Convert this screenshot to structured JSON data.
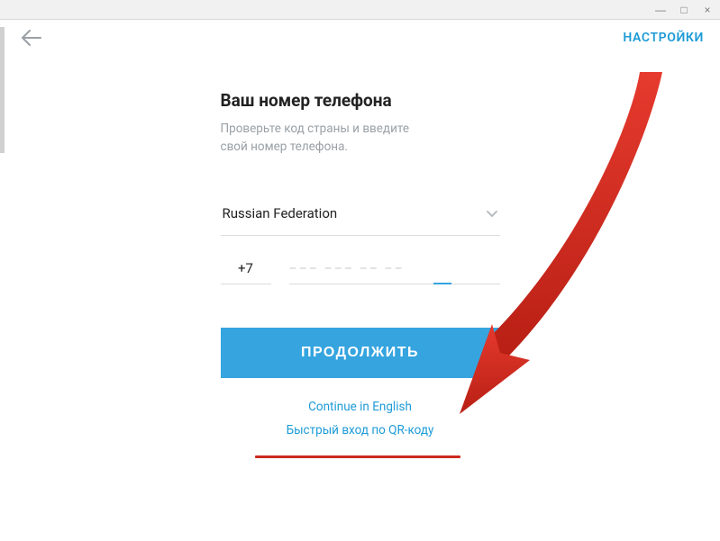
{
  "window": {
    "minimize": "—",
    "maximize": "□",
    "close": "×"
  },
  "header": {
    "settings": "НАСТРОЙКИ"
  },
  "form": {
    "title": "Ваш номер телефона",
    "subtitle1": "Проверьте код страны и введите",
    "subtitle2": "свой номер телефона.",
    "country": "Russian Federation",
    "code": "+7",
    "phone_placeholder": "––– ––– –– ––",
    "cta": "ПРОДОЛЖИТЬ",
    "english_link": "Continue in English",
    "qr_link": "Быстрый вход по QR-коду"
  }
}
